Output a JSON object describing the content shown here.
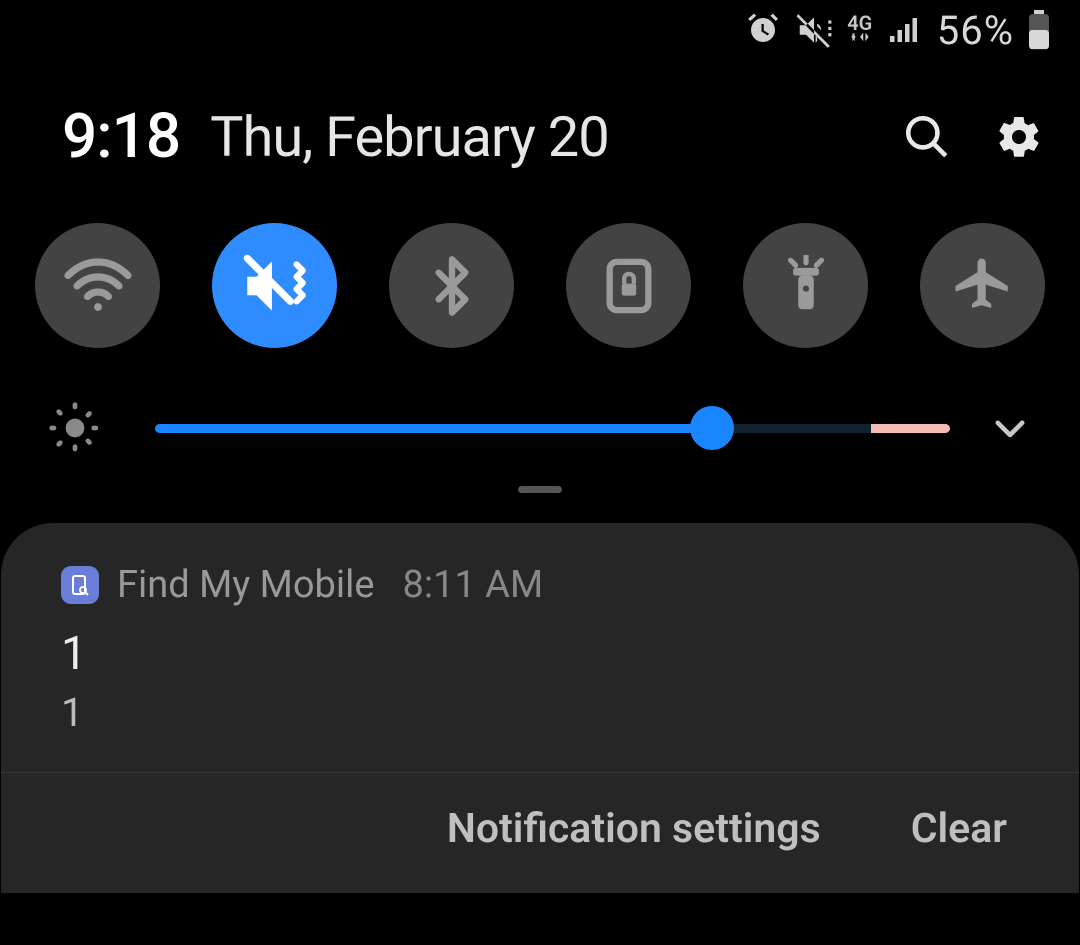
{
  "status": {
    "battery_percent": "56%",
    "network_label": "4G"
  },
  "header": {
    "time": "9:18",
    "date": "Thu, February 20"
  },
  "toggles": [
    {
      "name": "wifi",
      "active": false
    },
    {
      "name": "mute-vibrate",
      "active": true
    },
    {
      "name": "bluetooth",
      "active": false
    },
    {
      "name": "rotation-lock",
      "active": false
    },
    {
      "name": "flashlight",
      "active": false
    },
    {
      "name": "airplane",
      "active": false
    }
  ],
  "brightness": {
    "value_pct": 70,
    "warn_start_pct": 90
  },
  "notification": {
    "app_name": "Find My Mobile",
    "time": "8:11 AM",
    "title": "1",
    "body": "1"
  },
  "actions": {
    "settings": "Notification settings",
    "clear": "Clear"
  }
}
